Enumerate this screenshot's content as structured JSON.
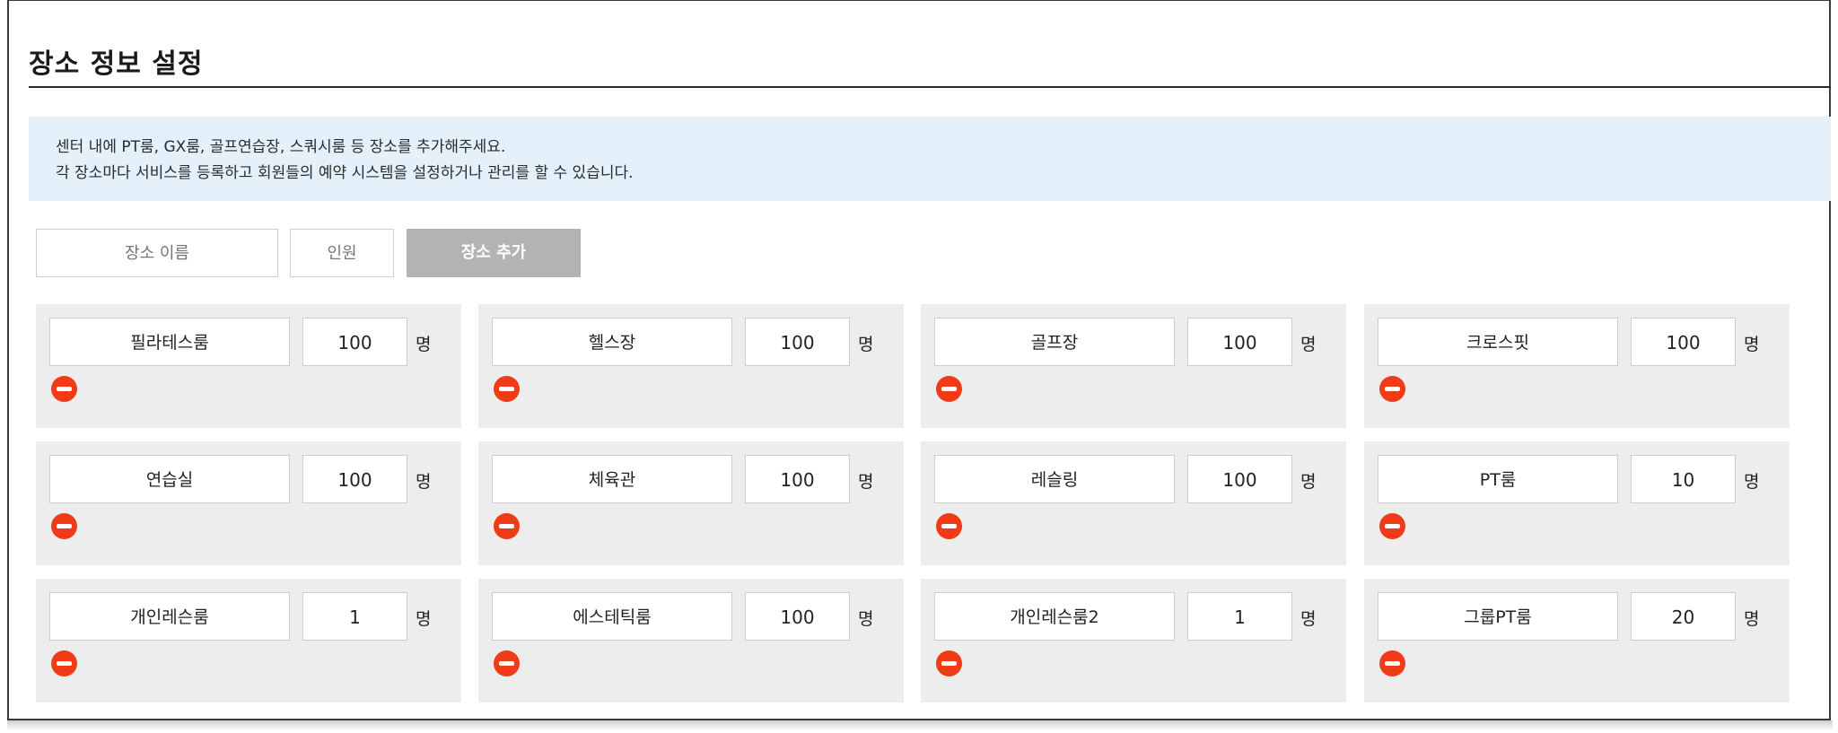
{
  "header": {
    "title": "장소 정보 설정"
  },
  "notice": {
    "line1": "센터 내에 PT룸, GX룸, 골프연습장, 스쿼시룸 등 장소를 추가해주세요.",
    "line2": "각 장소마다 서비스를 등록하고 회원들의 예약 시스템을 설정하거나 관리를 할 수 있습니다."
  },
  "add_form": {
    "name_placeholder": "장소 이름",
    "capacity_placeholder": "인원",
    "add_button_label": "장소 추가"
  },
  "unit_label": "명",
  "places": [
    {
      "name": "필라테스룸",
      "capacity": "100"
    },
    {
      "name": "헬스장",
      "capacity": "100"
    },
    {
      "name": "골프장",
      "capacity": "100"
    },
    {
      "name": "크로스핏",
      "capacity": "100"
    },
    {
      "name": "연습실",
      "capacity": "100"
    },
    {
      "name": "체육관",
      "capacity": "100"
    },
    {
      "name": "레슬링",
      "capacity": "100"
    },
    {
      "name": "PT룸",
      "capacity": "10"
    },
    {
      "name": "개인레슨룸",
      "capacity": "1"
    },
    {
      "name": "에스테틱룸",
      "capacity": "100"
    },
    {
      "name": "개인레슨룸2",
      "capacity": "1"
    },
    {
      "name": "그룹PT룸",
      "capacity": "20"
    }
  ],
  "icons": {
    "remove": "remove-circle-icon"
  },
  "colors": {
    "remove": "#ef3b16",
    "notice_bg": "#e4f1fb",
    "card_bg": "#ededed",
    "add_button_bg": "#b3b3b3"
  }
}
